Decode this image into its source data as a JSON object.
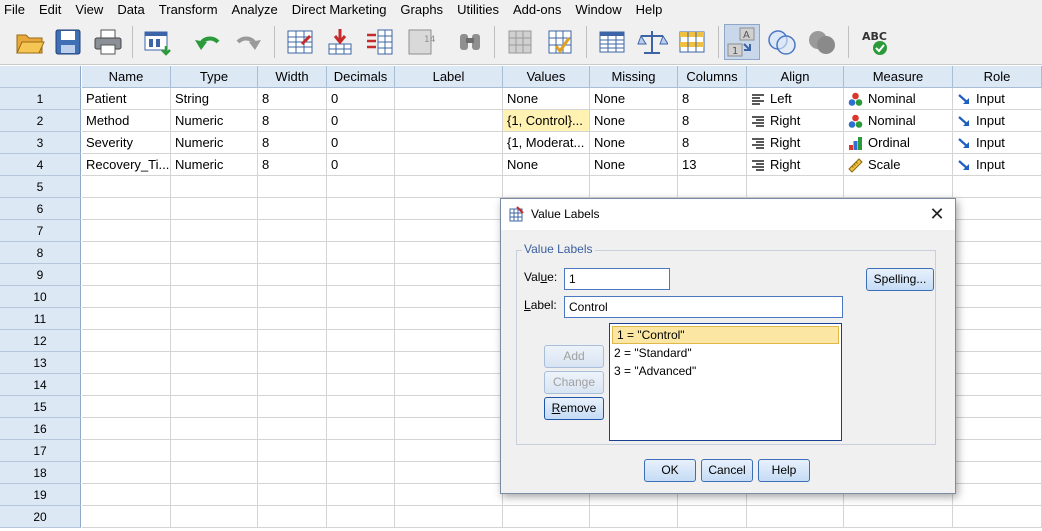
{
  "menu": [
    "File",
    "Edit",
    "View",
    "Data",
    "Transform",
    "Analyze",
    "Direct Marketing",
    "Graphs",
    "Utilities",
    "Add-ons",
    "Window",
    "Help"
  ],
  "toolbar_icons": [
    "open-icon",
    "save-icon",
    "print-icon",
    "recall-dialog-icon",
    "undo-icon",
    "redo-icon",
    "goto-case-icon",
    "goto-variable-icon",
    "variables-icon",
    "run-descriptives-icon",
    "find-icon",
    "insert-cases-icon",
    "insert-variable-icon",
    "split-file-icon",
    "weight-cases-icon",
    "select-cases-icon",
    "value-labels-icon",
    "use-variable-sets-icon",
    "show-all-variables-icon",
    "spell-check-icon"
  ],
  "columns": [
    "Name",
    "Type",
    "Width",
    "Decimals",
    "Label",
    "Values",
    "Missing",
    "Columns",
    "Align",
    "Measure",
    "Role"
  ],
  "rows": [
    {
      "num": "1",
      "name": "Patient",
      "type": "String",
      "width": "8",
      "decimals": "0",
      "label": "",
      "values": "None",
      "missing": "None",
      "columns": "8",
      "align": "Left",
      "measure": "Nominal",
      "role": "Input"
    },
    {
      "num": "2",
      "name": "Method",
      "type": "Numeric",
      "width": "8",
      "decimals": "0",
      "label": "",
      "values": "{1, Control}...",
      "missing": "None",
      "columns": "8",
      "align": "Right",
      "measure": "Nominal",
      "role": "Input"
    },
    {
      "num": "3",
      "name": "Severity",
      "type": "Numeric",
      "width": "8",
      "decimals": "0",
      "label": "",
      "values": "{1, Moderat...",
      "missing": "None",
      "columns": "8",
      "align": "Right",
      "measure": "Ordinal",
      "role": "Input"
    },
    {
      "num": "4",
      "name": "Recovery_Ti...",
      "type": "Numeric",
      "width": "8",
      "decimals": "0",
      "label": "",
      "values": "None",
      "missing": "None",
      "columns": "13",
      "align": "Right",
      "measure": "Scale",
      "role": "Input"
    }
  ],
  "empty_rows": [
    "5",
    "6",
    "7",
    "8",
    "9",
    "10",
    "11",
    "12",
    "13",
    "14",
    "15",
    "16",
    "17",
    "18",
    "19",
    "20"
  ],
  "dialog": {
    "title": "Value Labels",
    "group_title": "Value Labels",
    "value_label_pre": "Val",
    "value_label_u": "u",
    "value_label_post": "e:",
    "value_input": "1",
    "label_label_u": "L",
    "label_label_post": "abel:",
    "label_input": "Control",
    "spelling": "Spelling...",
    "add": "Add",
    "change": "Change",
    "remove": "Remove",
    "list": [
      "1 = \"Control\"",
      "2 = \"Standard\"",
      "3 = \"Advanced\""
    ],
    "ok": "OK",
    "cancel": "Cancel",
    "help": "Help"
  }
}
